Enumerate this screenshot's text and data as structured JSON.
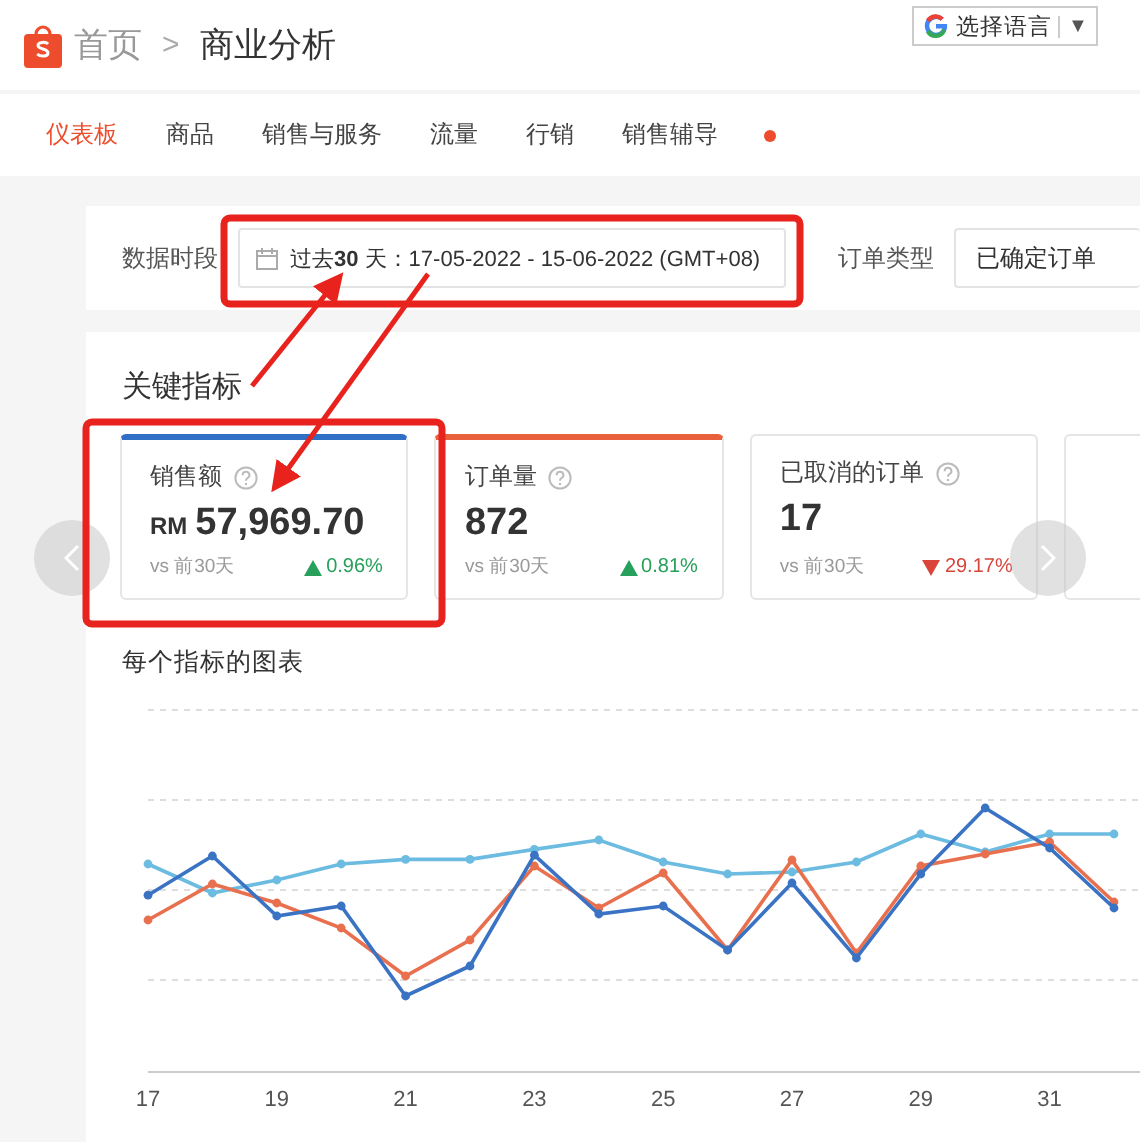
{
  "header": {
    "breadcrumb": [
      "首页",
      "商业分析"
    ],
    "breadcrumb_separator": ">",
    "language_button": "选择语言",
    "language_caret": "▼"
  },
  "tabs": [
    {
      "label": "仪表板",
      "selected": true,
      "dot": false
    },
    {
      "label": "商品",
      "selected": false,
      "dot": false
    },
    {
      "label": "销售与服务",
      "selected": false,
      "dot": false
    },
    {
      "label": "流量",
      "selected": false,
      "dot": false
    },
    {
      "label": "行销",
      "selected": false,
      "dot": false
    },
    {
      "label": "销售辅导",
      "selected": false,
      "dot": true
    }
  ],
  "filters": {
    "period_label": "数据时段",
    "period_value": "过去**30** 天：17-05-2022 - 15-06-2022 (GMT+08)",
    "order_type_label": "订单类型",
    "order_type_value": "已确定订单"
  },
  "key_metrics": {
    "title": "关键指标",
    "cards": [
      {
        "title": "销售额",
        "currency": "RM",
        "value": "57,969.70",
        "compare": "vs 前30天",
        "increase": true,
        "change": "0.96%",
        "selected": true,
        "color": "#2f6fc5"
      },
      {
        "title": "订单量",
        "value": "872",
        "compare": "vs 前30天",
        "increase": true,
        "change": "0.81%",
        "selected": true,
        "color": "#e8603c"
      },
      {
        "title": "已取消的订单",
        "value": "17",
        "compare": "vs 前30天",
        "increase": false,
        "change": "29.17%",
        "selected": false
      }
    ]
  },
  "chart_section": {
    "title": "每个指标的图表",
    "x_labels": [
      "17",
      "19",
      "21",
      "23",
      "25",
      "27",
      "29",
      "31"
    ]
  }
}
